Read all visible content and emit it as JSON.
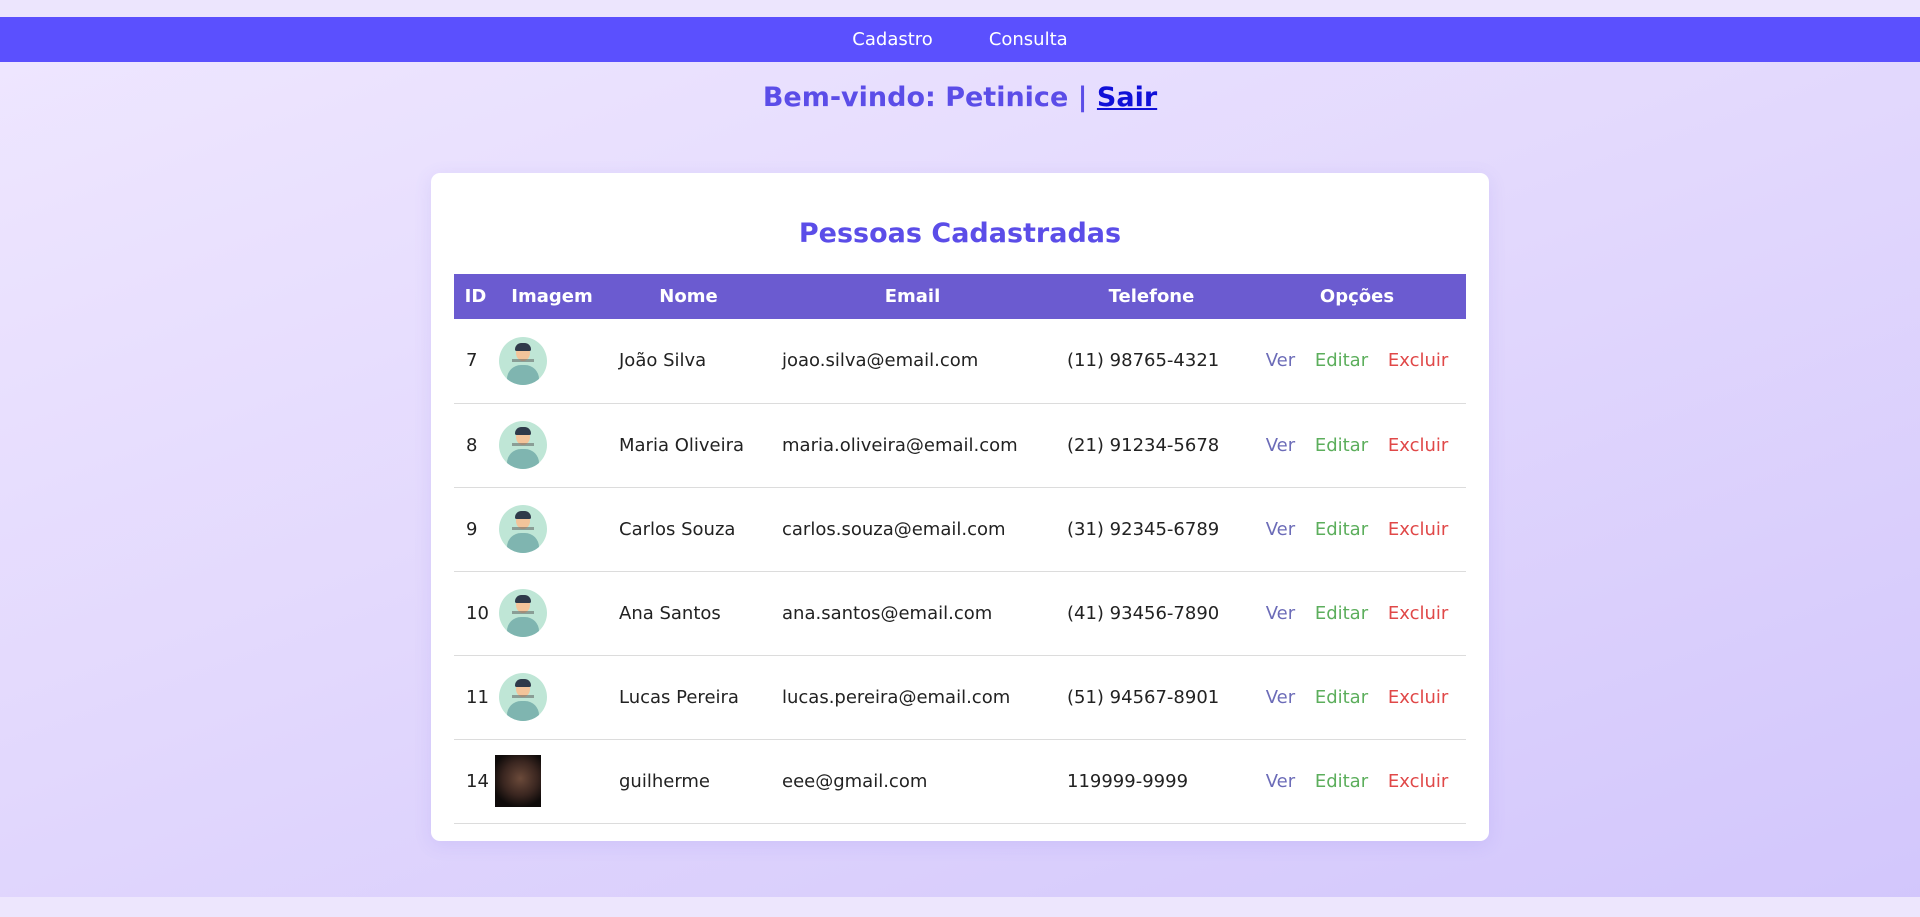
{
  "nav": {
    "items": [
      "Cadastro",
      "Consulta"
    ]
  },
  "welcome": {
    "text": "Bem-vindo: Petinice | ",
    "logout_label": "Sair"
  },
  "card": {
    "title": "Pessoas Cadastradas"
  },
  "table": {
    "columns": [
      "ID",
      "Imagem",
      "Nome",
      "Email",
      "Telefone",
      "Opções"
    ],
    "option_labels": {
      "view": "Ver",
      "edit": "Editar",
      "delete": "Excluir"
    },
    "rows": [
      {
        "id": "7",
        "image": "default-avatar-icon",
        "name": "João Silva",
        "email": "joao.silva@email.com",
        "phone": "(11) 98765-4321"
      },
      {
        "id": "8",
        "image": "default-avatar-icon",
        "name": "Maria Oliveira",
        "email": "maria.oliveira@email.com",
        "phone": "(21) 91234-5678"
      },
      {
        "id": "9",
        "image": "default-avatar-icon",
        "name": "Carlos Souza",
        "email": "carlos.souza@email.com",
        "phone": "(31) 92345-6789"
      },
      {
        "id": "10",
        "image": "default-avatar-icon",
        "name": "Ana Santos",
        "email": "ana.santos@email.com",
        "phone": "(41) 93456-7890"
      },
      {
        "id": "11",
        "image": "default-avatar-icon",
        "name": "Lucas Pereira",
        "email": "lucas.pereira@email.com",
        "phone": "(51) 94567-8901"
      },
      {
        "id": "14",
        "image": "user-photo",
        "name": "guilherme",
        "email": "eee@gmail.com",
        "phone": "119999-9999"
      }
    ]
  },
  "colors": {
    "navbar": "#5b50fe",
    "heading": "#5b4de8",
    "table_header": "#6b5bd0",
    "link_ver": "#6c6cb8",
    "link_editar": "#5cae5c",
    "link_excluir": "#e04848"
  }
}
